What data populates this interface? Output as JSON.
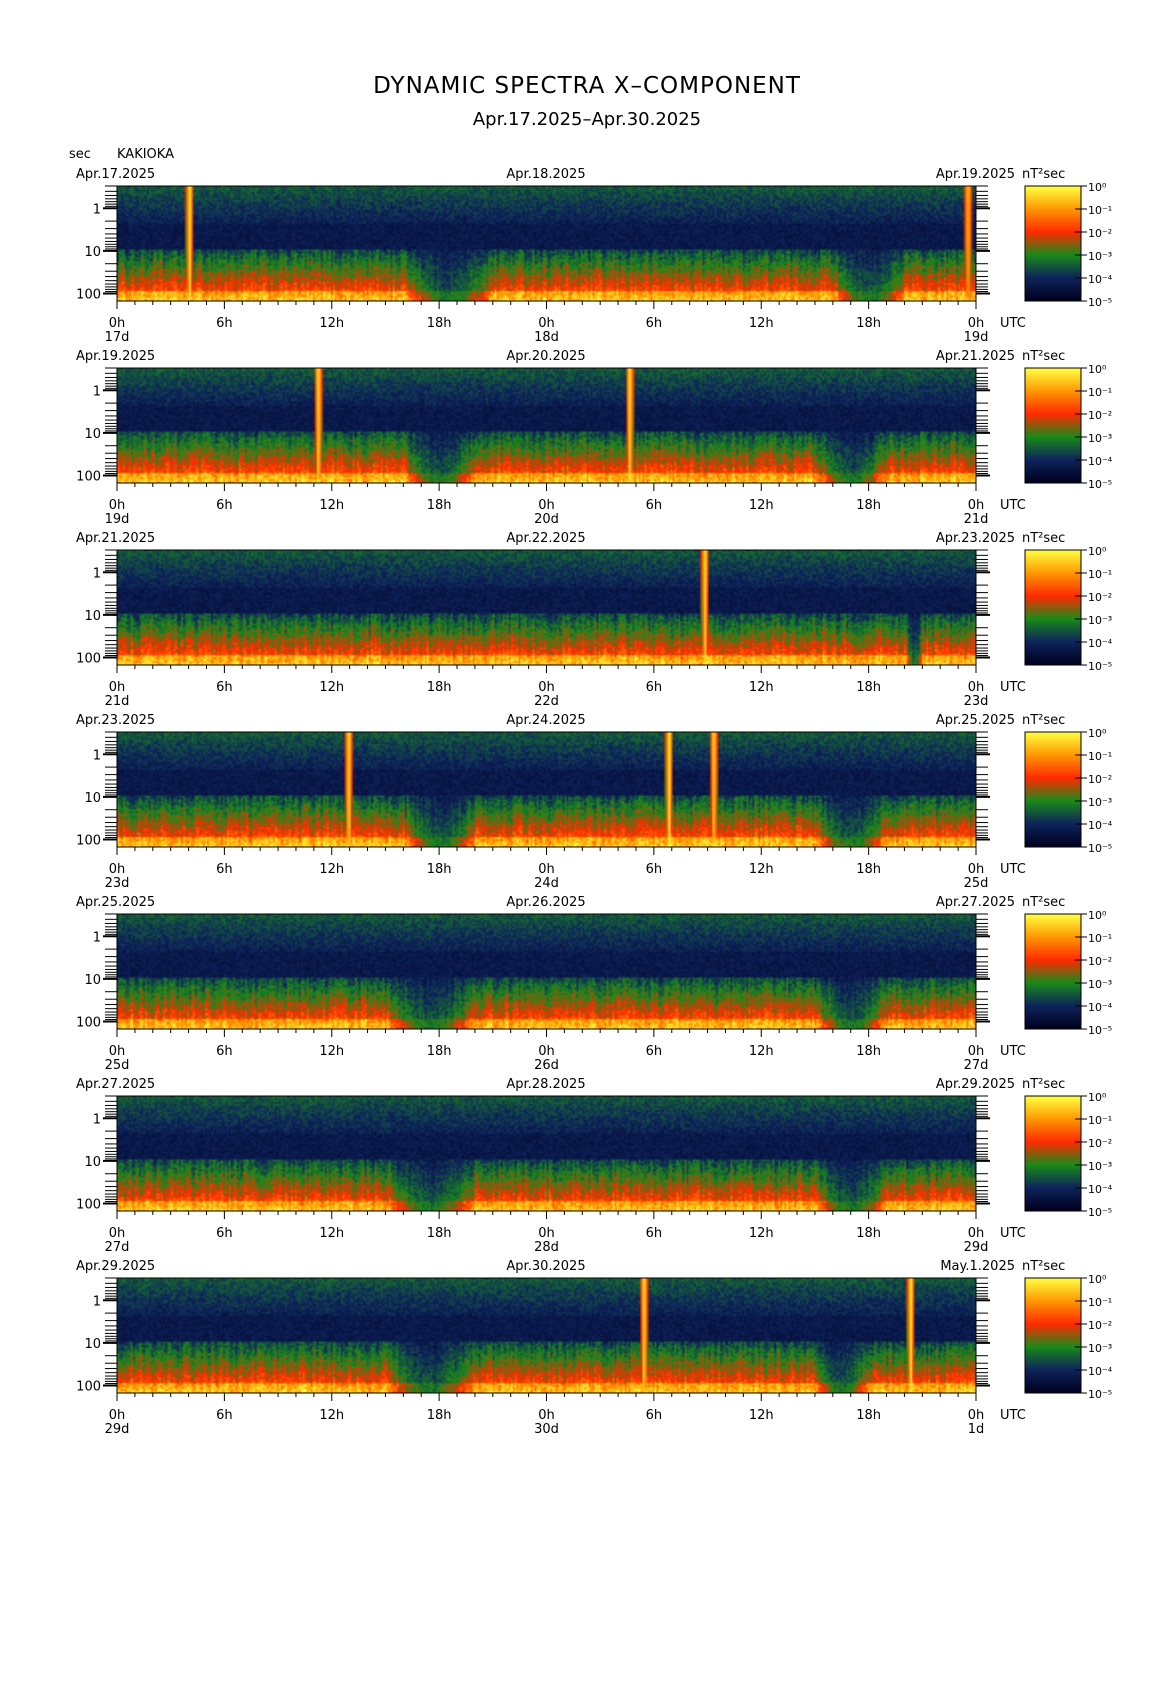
{
  "title": "DYNAMIC SPECTRA X–COMPONENT",
  "subtitle": "Apr.17.2025–Apr.30.2025",
  "y_unit": "sec",
  "station": "KAKIOKA",
  "utc_label": "UTC",
  "cbar_unit": "nT²sec",
  "x_ticks": [
    "0h",
    "6h",
    "12h",
    "18h",
    "0h",
    "6h",
    "12h",
    "18h",
    "0h"
  ],
  "y_ticks": [
    "1",
    "10",
    "100"
  ],
  "cbar_ticks": [
    "10⁰",
    "10⁻¹",
    "10⁻²",
    "10⁻³",
    "10⁻⁴",
    "10⁻⁵"
  ],
  "colors": {
    "low": "#000020",
    "mid": "#1a8a1a",
    "high": "#ff2a00",
    "max": "#ffff40"
  },
  "chart_data": [
    {
      "type": "heatmap",
      "dates": [
        "Apr.17.2025",
        "Apr.18.2025",
        "Apr.19.2025"
      ],
      "days": [
        "17d",
        "18d",
        "19d"
      ],
      "ylim": [
        0.3,
        150
      ],
      "yscale": "log",
      "events": [
        {
          "hour": 4.0,
          "strength": 1.0
        },
        {
          "hour": 47.5,
          "strength": 0.85
        }
      ],
      "quiet": [
        16,
        21,
        40,
        44
      ]
    },
    {
      "type": "heatmap",
      "dates": [
        "Apr.19.2025",
        "Apr.20.2025",
        "Apr.21.2025"
      ],
      "days": [
        "19d",
        "20d",
        "21d"
      ],
      "ylim": [
        0.3,
        150
      ],
      "yscale": "log",
      "events": [
        {
          "hour": 11.2,
          "strength": 1.0
        },
        {
          "hour": 28.6,
          "strength": 1.0
        }
      ],
      "quiet": [
        16,
        20,
        39,
        43
      ]
    },
    {
      "type": "heatmap",
      "dates": [
        "Apr.21.2025",
        "Apr.22.2025",
        "Apr.23.2025"
      ],
      "days": [
        "21d",
        "22d",
        "23d"
      ],
      "ylim": [
        0.3,
        150
      ],
      "yscale": "log",
      "events": [
        {
          "hour": 32.8,
          "strength": 0.95
        }
      ],
      "quiet": [
        44,
        45
      ]
    },
    {
      "type": "heatmap",
      "dates": [
        "Apr.23.2025",
        "Apr.24.2025",
        "Apr.25.2025"
      ],
      "days": [
        "23d",
        "24d",
        "25d"
      ],
      "ylim": [
        0.3,
        150
      ],
      "yscale": "log",
      "events": [
        {
          "hour": 12.9,
          "strength": 1.0
        },
        {
          "hour": 30.8,
          "strength": 1.0
        },
        {
          "hour": 33.3,
          "strength": 0.95
        }
      ],
      "quiet": [
        16,
        20,
        39,
        43
      ]
    },
    {
      "type": "heatmap",
      "dates": [
        "Apr.25.2025",
        "Apr.26.2025",
        "Apr.27.2025"
      ],
      "days": [
        "25d",
        "26d",
        "27d"
      ],
      "ylim": [
        0.3,
        150
      ],
      "yscale": "log",
      "events": [],
      "quiet": [
        15,
        20,
        39,
        43
      ]
    },
    {
      "type": "heatmap",
      "dates": [
        "Apr.27.2025",
        "Apr.28.2025",
        "Apr.29.2025"
      ],
      "days": [
        "27d",
        "28d",
        "29d"
      ],
      "ylim": [
        0.3,
        150
      ],
      "yscale": "log",
      "events": [],
      "quiet": [
        15,
        20,
        39,
        43
      ]
    },
    {
      "type": "heatmap",
      "dates": [
        "Apr.29.2025",
        "Apr.30.2025",
        "May.1.2025"
      ],
      "days": [
        "29d",
        "30d",
        "1d"
      ],
      "ylim": [
        0.3,
        150
      ],
      "yscale": "log",
      "events": [
        {
          "hour": 29.4,
          "strength": 1.0
        },
        {
          "hour": 44.3,
          "strength": 1.0
        }
      ],
      "quiet": [
        15,
        20,
        39,
        42
      ]
    }
  ]
}
